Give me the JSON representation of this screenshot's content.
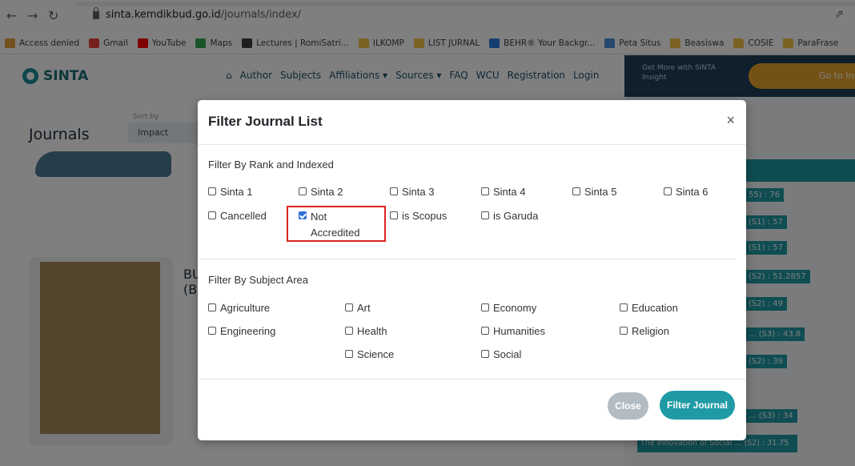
{
  "browser": {
    "url_host": "sinta.kemdikbud.go.id",
    "url_path": "/journals/index/",
    "bookmarks": [
      {
        "label": "Access denied",
        "icon": "pma-icon",
        "color": "#e8a13a"
      },
      {
        "label": "Gmail",
        "icon": "gmail-icon",
        "color": "#ea4335"
      },
      {
        "label": "YouTube",
        "icon": "youtube-icon",
        "color": "#ff0000"
      },
      {
        "label": "Maps",
        "icon": "maps-icon",
        "color": "#34a853"
      },
      {
        "label": "Lectures | RomiSatri...",
        "icon": "lectures-icon",
        "color": "#3c3c3c"
      },
      {
        "label": "ILKOMP",
        "icon": "folder-icon",
        "color": "#f6c244"
      },
      {
        "label": "LIST JURNAL",
        "icon": "folder-icon",
        "color": "#f6c244"
      },
      {
        "label": "BEHR® Your Backgr...",
        "icon": "behr-icon",
        "color": "#2a7de1"
      },
      {
        "label": "Peta Situs",
        "icon": "peta-icon",
        "color": "#4a90d9"
      },
      {
        "label": "Beasiswa",
        "icon": "folder-icon",
        "color": "#f6c244"
      },
      {
        "label": "COSIE",
        "icon": "folder-icon",
        "color": "#f6c244"
      },
      {
        "label": "ParaFrase",
        "icon": "folder-icon",
        "color": "#f6c244"
      }
    ],
    "more": "»"
  },
  "site": {
    "logo": "SINTA",
    "nav": [
      "Author",
      "Subjects",
      "Affiliations ▾",
      "Sources ▾",
      "FAQ",
      "WCU",
      "Registration",
      "Login"
    ],
    "banner_text": "Get More with SINTA Insight",
    "banner_button": "Go to Ins",
    "page_title": "Journals",
    "sort_label": "Sort by",
    "sort_value": "Impact",
    "journal_title": "BU",
    "journal_title2": "(BI",
    "side_chips": [
      "55) : 76",
      "(S1) : 57",
      "(S1) : 57",
      "(S2) : 51.2857",
      "(S2) : 49",
      "... (S3) : 43.8",
      "(S2) : 39",
      "... (S3) : 34",
      "The Innovation of Social ... (S2) : 31.75"
    ]
  },
  "modal": {
    "title": "Filter Journal List",
    "close_x": "×",
    "section_rank": "Filter By Rank and Indexed",
    "rank_options": [
      {
        "label": "Sinta 1",
        "checked": false
      },
      {
        "label": "Sinta 2",
        "checked": false
      },
      {
        "label": "Sinta 3",
        "checked": false
      },
      {
        "label": "Sinta 4",
        "checked": false
      },
      {
        "label": "Sinta 5",
        "checked": false
      },
      {
        "label": "Sinta 6",
        "checked": false
      },
      {
        "label": "Cancelled",
        "checked": false
      },
      {
        "label": "Not Accredited",
        "checked": true
      },
      {
        "label": "is Scopus",
        "checked": false
      },
      {
        "label": "is Garuda",
        "checked": false
      }
    ],
    "section_subject": "Filter By Subject Area",
    "subject_options": [
      {
        "label": "Agriculture",
        "checked": false
      },
      {
        "label": "Art",
        "checked": false
      },
      {
        "label": "Economy",
        "checked": false
      },
      {
        "label": "Education",
        "checked": false
      },
      {
        "label": "Engineering",
        "checked": false
      },
      {
        "label": "Health",
        "checked": false
      },
      {
        "label": "Humanities",
        "checked": false
      },
      {
        "label": "Religion",
        "checked": false
      },
      {
        "label": "Science",
        "checked": false
      },
      {
        "label": "Social",
        "checked": false
      }
    ],
    "close_button": "Close",
    "filter_button": "Filter Journal"
  }
}
